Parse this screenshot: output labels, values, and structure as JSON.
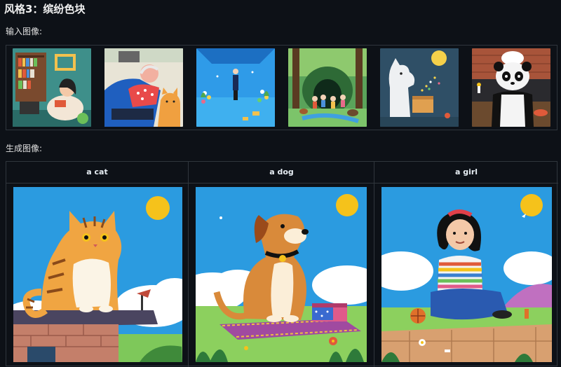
{
  "page": {
    "title": "风格3：缤纷色块",
    "input_label": "输入图像:",
    "output_label": "生成图像:"
  },
  "input_images": [
    {
      "icon": "woman-reading-in-library"
    },
    {
      "icon": "man-sleeping-with-cat"
    },
    {
      "icon": "person-in-blue-room"
    },
    {
      "icon": "children-in-forest"
    },
    {
      "icon": "moomin-with-box"
    },
    {
      "icon": "panda-chef"
    }
  ],
  "generated": [
    {
      "header": "a cat",
      "icon": "cat-on-chimney"
    },
    {
      "header": "a dog",
      "icon": "dog-on-rug"
    },
    {
      "header": "a girl",
      "icon": "girl-sitting"
    }
  ],
  "colors": {
    "background": "#0d1117",
    "border": "#30363d",
    "sky": "#2b9be0",
    "sun": "#f5c21b"
  }
}
